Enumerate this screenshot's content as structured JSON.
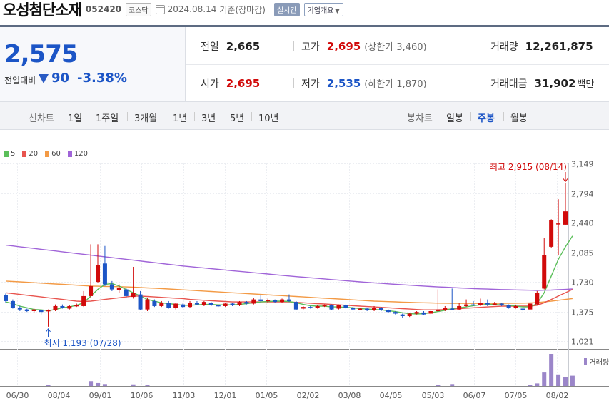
{
  "header": {
    "name": "오성첨단소재",
    "code": "052420",
    "market": "코스닥",
    "date": "2024.08.14",
    "basis": "기준(장마감)",
    "realtime": "실시간",
    "corp_info": "기업개요"
  },
  "quote": {
    "price": "2,575",
    "compare_label": "전일대비",
    "change": "90",
    "change_pct": "-3.38%",
    "prev_close_label": "전일",
    "prev_close": "2,665",
    "high_label": "고가",
    "high": "2,695",
    "upper_limit": "(상한가 3,460)",
    "volume_label": "거래량",
    "volume": "12,261,875",
    "open_label": "시가",
    "open": "2,695",
    "low_label": "저가",
    "low": "2,535",
    "lower_limit": "(하한가 1,870)",
    "amount_label": "거래대금",
    "amount": "31,902",
    "amount_unit": "백만"
  },
  "periods": {
    "line_label": "선차트",
    "line_items": [
      "1일",
      "1주일",
      "3개월",
      "1년",
      "3년",
      "5년",
      "10년"
    ],
    "candle_label": "봉차트",
    "candle_items": [
      "일봉",
      "주봉",
      "월봉"
    ],
    "active": "주봉"
  },
  "colors": {
    "up": "#d10a0a",
    "down": "#1c55c6",
    "ma5": "#5bbf5a",
    "ma20": "#e8544e",
    "ma60": "#f39a45",
    "ma120": "#a064d8",
    "volume": "#9b86c9"
  },
  "chart_data": {
    "type": "candlestick",
    "y_ticks": [
      "3,149",
      "2,794",
      "2,440",
      "2,085",
      "1,730",
      "1,375",
      "1,021"
    ],
    "ylim": [
      1021,
      3149
    ],
    "x_tick_labels": [
      "06/30",
      "08/04",
      "09/01",
      "10/06",
      "11/03",
      "12/01",
      "01/05",
      "02/02",
      "03/08",
      "04/05",
      "05/03",
      "06/07",
      "07/05",
      "08/02"
    ],
    "legend": [
      "5",
      "20",
      "60",
      "120"
    ],
    "volume_label": "거래량",
    "high_annotation": "최고 2,915 (08/14)",
    "low_annotation": "최저 1,193 (07/28)",
    "candles": [
      {
        "o": 1570,
        "c": 1500,
        "h": 1590,
        "l": 1480
      },
      {
        "o": 1500,
        "c": 1420,
        "h": 1520,
        "l": 1410
      },
      {
        "o": 1420,
        "c": 1400,
        "h": 1440,
        "l": 1380
      },
      {
        "o": 1400,
        "c": 1380,
        "h": 1410,
        "l": 1370
      },
      {
        "o": 1380,
        "c": 1400,
        "h": 1410,
        "l": 1360
      },
      {
        "o": 1390,
        "c": 1370,
        "h": 1400,
        "l": 1340
      },
      {
        "o": 1380,
        "c": 1390,
        "h": 1400,
        "l": 1193
      },
      {
        "o": 1390,
        "c": 1440,
        "h": 1460,
        "l": 1380
      },
      {
        "o": 1440,
        "c": 1420,
        "h": 1460,
        "l": 1410
      },
      {
        "o": 1410,
        "c": 1440,
        "h": 1450,
        "l": 1400
      },
      {
        "o": 1440,
        "c": 1450,
        "h": 1470,
        "l": 1430
      },
      {
        "o": 1440,
        "c": 1560,
        "h": 1620,
        "l": 1430
      },
      {
        "o": 1560,
        "c": 1680,
        "h": 2180,
        "l": 1540
      },
      {
        "o": 1730,
        "c": 1930,
        "h": 2180,
        "l": 1720
      },
      {
        "o": 1950,
        "c": 1700,
        "h": 2160,
        "l": 1680
      },
      {
        "o": 1700,
        "c": 1640,
        "h": 1740,
        "l": 1620
      },
      {
        "o": 1630,
        "c": 1660,
        "h": 1700,
        "l": 1600
      },
      {
        "o": 1640,
        "c": 1560,
        "h": 1660,
        "l": 1540
      },
      {
        "o": 1550,
        "c": 1600,
        "h": 1910,
        "l": 1530
      },
      {
        "o": 1580,
        "c": 1400,
        "h": 1620,
        "l": 1390
      },
      {
        "o": 1400,
        "c": 1520,
        "h": 1540,
        "l": 1380
      },
      {
        "o": 1500,
        "c": 1440,
        "h": 1520,
        "l": 1430
      },
      {
        "o": 1440,
        "c": 1480,
        "h": 1500,
        "l": 1430
      },
      {
        "o": 1480,
        "c": 1420,
        "h": 1500,
        "l": 1410
      },
      {
        "o": 1420,
        "c": 1470,
        "h": 1480,
        "l": 1400
      },
      {
        "o": 1460,
        "c": 1430,
        "h": 1470,
        "l": 1420
      },
      {
        "o": 1430,
        "c": 1480,
        "h": 1500,
        "l": 1420
      },
      {
        "o": 1480,
        "c": 1460,
        "h": 1500,
        "l": 1450
      },
      {
        "o": 1450,
        "c": 1490,
        "h": 1500,
        "l": 1440
      },
      {
        "o": 1480,
        "c": 1450,
        "h": 1490,
        "l": 1440
      },
      {
        "o": 1450,
        "c": 1440,
        "h": 1460,
        "l": 1430
      },
      {
        "o": 1440,
        "c": 1470,
        "h": 1480,
        "l": 1430
      },
      {
        "o": 1470,
        "c": 1450,
        "h": 1480,
        "l": 1440
      },
      {
        "o": 1450,
        "c": 1490,
        "h": 1500,
        "l": 1440
      },
      {
        "o": 1490,
        "c": 1470,
        "h": 1500,
        "l": 1460
      },
      {
        "o": 1470,
        "c": 1520,
        "h": 1540,
        "l": 1460
      },
      {
        "o": 1520,
        "c": 1500,
        "h": 1570,
        "l": 1490
      },
      {
        "o": 1500,
        "c": 1510,
        "h": 1530,
        "l": 1480
      },
      {
        "o": 1510,
        "c": 1490,
        "h": 1520,
        "l": 1480
      },
      {
        "o": 1490,
        "c": 1520,
        "h": 1530,
        "l": 1480
      },
      {
        "o": 1520,
        "c": 1500,
        "h": 1580,
        "l": 1490
      },
      {
        "o": 1490,
        "c": 1400,
        "h": 1500,
        "l": 1390
      },
      {
        "o": 1410,
        "c": 1430,
        "h": 1440,
        "l": 1400
      },
      {
        "o": 1430,
        "c": 1420,
        "h": 1440,
        "l": 1410
      },
      {
        "o": 1420,
        "c": 1440,
        "h": 1450,
        "l": 1410
      },
      {
        "o": 1440,
        "c": 1450,
        "h": 1460,
        "l": 1430
      },
      {
        "o": 1450,
        "c": 1400,
        "h": 1460,
        "l": 1390
      },
      {
        "o": 1410,
        "c": 1450,
        "h": 1460,
        "l": 1400
      },
      {
        "o": 1450,
        "c": 1420,
        "h": 1460,
        "l": 1410
      },
      {
        "o": 1420,
        "c": 1400,
        "h": 1430,
        "l": 1390
      },
      {
        "o": 1400,
        "c": 1410,
        "h": 1420,
        "l": 1390
      },
      {
        "o": 1410,
        "c": 1390,
        "h": 1420,
        "l": 1380
      },
      {
        "o": 1390,
        "c": 1420,
        "h": 1440,
        "l": 1380
      },
      {
        "o": 1420,
        "c": 1390,
        "h": 1430,
        "l": 1380
      },
      {
        "o": 1390,
        "c": 1370,
        "h": 1400,
        "l": 1360
      },
      {
        "o": 1370,
        "c": 1350,
        "h": 1380,
        "l": 1340
      },
      {
        "o": 1340,
        "c": 1320,
        "h": 1350,
        "l": 1300
      },
      {
        "o": 1320,
        "c": 1350,
        "h": 1360,
        "l": 1310
      },
      {
        "o": 1350,
        "c": 1370,
        "h": 1380,
        "l": 1340
      },
      {
        "o": 1360,
        "c": 1340,
        "h": 1380,
        "l": 1330
      },
      {
        "o": 1350,
        "c": 1380,
        "h": 1390,
        "l": 1340
      },
      {
        "o": 1380,
        "c": 1400,
        "h": 1640,
        "l": 1370
      },
      {
        "o": 1390,
        "c": 1420,
        "h": 1440,
        "l": 1380
      },
      {
        "o": 1410,
        "c": 1400,
        "h": 1650,
        "l": 1390
      },
      {
        "o": 1400,
        "c": 1440,
        "h": 1480,
        "l": 1390
      },
      {
        "o": 1440,
        "c": 1460,
        "h": 1520,
        "l": 1430
      },
      {
        "o": 1460,
        "c": 1450,
        "h": 1500,
        "l": 1440
      },
      {
        "o": 1450,
        "c": 1480,
        "h": 1530,
        "l": 1440
      },
      {
        "o": 1480,
        "c": 1460,
        "h": 1520,
        "l": 1440
      },
      {
        "o": 1460,
        "c": 1470,
        "h": 1490,
        "l": 1450
      },
      {
        "o": 1470,
        "c": 1450,
        "h": 1480,
        "l": 1440
      },
      {
        "o": 1450,
        "c": 1420,
        "h": 1460,
        "l": 1410
      },
      {
        "o": 1420,
        "c": 1440,
        "h": 1450,
        "l": 1410
      },
      {
        "o": 1410,
        "c": 1390,
        "h": 1420,
        "l": 1380
      },
      {
        "o": 1400,
        "c": 1470,
        "h": 1480,
        "l": 1390
      },
      {
        "o": 1460,
        "c": 1600,
        "h": 1620,
        "l": 1450
      },
      {
        "o": 1650,
        "c": 2050,
        "h": 2260,
        "l": 1640
      },
      {
        "o": 2150,
        "c": 2470,
        "h": 2480,
        "l": 2140
      },
      {
        "o": 2420,
        "c": 2430,
        "h": 2720,
        "l": 2050
      },
      {
        "o": 2415,
        "c": 2575,
        "h": 2915,
        "l": 2410
      }
    ],
    "volumes": [
      0,
      0,
      0,
      0,
      0,
      0,
      0.03,
      0,
      0,
      0,
      0,
      0,
      0.15,
      0.09,
      0.06,
      0,
      0,
      0,
      0.05,
      0,
      0.03,
      0,
      0,
      0,
      0,
      0,
      0,
      0,
      0,
      0,
      0,
      0,
      0,
      0,
      0,
      0,
      0,
      0,
      0,
      0,
      0,
      0,
      0,
      0,
      0,
      0,
      0,
      0,
      0,
      0,
      0,
      0,
      0,
      0,
      0,
      0,
      0,
      0,
      0,
      0,
      0,
      0.03,
      0,
      0.06,
      0,
      0,
      0,
      0,
      0,
      0,
      0,
      0,
      0,
      0,
      0.03,
      0.08,
      0.42,
      1.0,
      0.36,
      0.28,
      0.32
    ],
    "ma5": [
      1490,
      1470,
      1440,
      1420,
      1400,
      1395,
      1385,
      1400,
      1420,
      1430,
      1450,
      1480,
      1560,
      1640,
      1700,
      1710,
      1680,
      1640,
      1600,
      1560,
      1520,
      1500,
      1480,
      1470,
      1460,
      1450,
      1450,
      1455,
      1460,
      1460,
      1455,
      1455,
      1455,
      1460,
      1470,
      1480,
      1490,
      1495,
      1500,
      1500,
      1495,
      1480,
      1460,
      1445,
      1440,
      1440,
      1430,
      1430,
      1425,
      1420,
      1410,
      1405,
      1400,
      1395,
      1385,
      1375,
      1360,
      1350,
      1345,
      1350,
      1360,
      1375,
      1390,
      1410,
      1420,
      1430,
      1445,
      1455,
      1460,
      1460,
      1455,
      1450,
      1440,
      1430,
      1430,
      1470,
      1600,
      1800,
      2000,
      2150,
      2280
    ],
    "ma20": [
      1600,
      1590,
      1580,
      1570,
      1560,
      1550,
      1540,
      1530,
      1520,
      1510,
      1500,
      1495,
      1500,
      1510,
      1520,
      1530,
      1540,
      1550,
      1560,
      1560,
      1555,
      1550,
      1545,
      1540,
      1535,
      1530,
      1520,
      1515,
      1510,
      1505,
      1500,
      1495,
      1490,
      1490,
      1490,
      1490,
      1490,
      1490,
      1490,
      1490,
      1490,
      1485,
      1480,
      1475,
      1470,
      1465,
      1460,
      1455,
      1450,
      1445,
      1440,
      1435,
      1430,
      1425,
      1420,
      1415,
      1410,
      1405,
      1400,
      1395,
      1395,
      1395,
      1400,
      1405,
      1410,
      1415,
      1420,
      1425,
      1430,
      1435,
      1440,
      1440,
      1440,
      1440,
      1440,
      1450,
      1480,
      1520,
      1560,
      1600,
      1640
    ],
    "ma60": [
      1740,
      1735,
      1730,
      1725,
      1720,
      1715,
      1710,
      1705,
      1700,
      1695,
      1690,
      1685,
      1680,
      1678,
      1676,
      1674,
      1672,
      1670,
      1666,
      1662,
      1658,
      1654,
      1650,
      1645,
      1640,
      1635,
      1630,
      1625,
      1620,
      1615,
      1610,
      1605,
      1600,
      1595,
      1590,
      1585,
      1580,
      1575,
      1570,
      1565,
      1560,
      1555,
      1550,
      1545,
      1540,
      1535,
      1530,
      1525,
      1520,
      1515,
      1510,
      1505,
      1500,
      1497,
      1494,
      1491,
      1488,
      1485,
      1482,
      1480,
      1478,
      1476,
      1475,
      1474,
      1473,
      1472,
      1472,
      1472,
      1472,
      1472,
      1473,
      1474,
      1475,
      1476,
      1478,
      1482,
      1490,
      1500,
      1510,
      1520,
      1530
    ],
    "ma120": [
      2170,
      2160,
      2150,
      2140,
      2130,
      2120,
      2110,
      2100,
      2090,
      2080,
      2070,
      2060,
      2050,
      2040,
      2030,
      2020,
      2010,
      2000,
      1990,
      1980,
      1970,
      1960,
      1950,
      1940,
      1930,
      1920,
      1912,
      1904,
      1896,
      1888,
      1880,
      1872,
      1864,
      1856,
      1848,
      1840,
      1832,
      1824,
      1816,
      1808,
      1800,
      1793,
      1786,
      1779,
      1772,
      1765,
      1758,
      1751,
      1744,
      1737,
      1730,
      1724,
      1718,
      1712,
      1706,
      1700,
      1695,
      1690,
      1685,
      1680,
      1675,
      1670,
      1666,
      1662,
      1658,
      1654,
      1650,
      1647,
      1644,
      1641,
      1638,
      1636,
      1634,
      1632,
      1630,
      1628,
      1630,
      1632,
      1636,
      1640,
      1645
    ]
  }
}
